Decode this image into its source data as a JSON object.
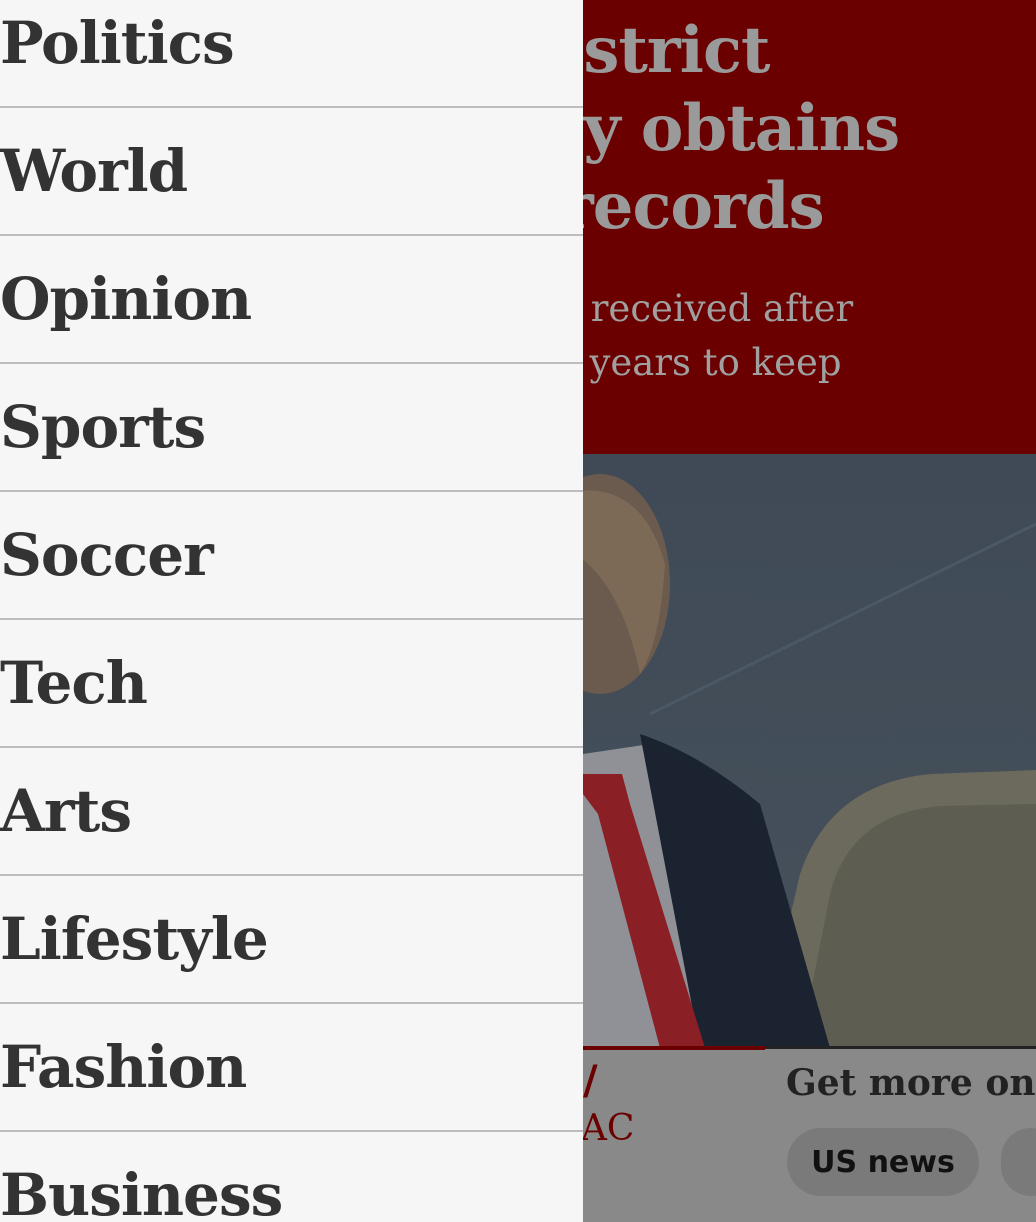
{
  "article": {
    "headline_lines": [
      "istrict",
      "ly obtains",
      "records"
    ],
    "standfirst_lines": [
      "s received after",
      "r years to keep"
    ],
    "kicker_slash": "/",
    "kicker_text": "PAC",
    "more_heading": "Get more on t",
    "chips": [
      "US news",
      ""
    ]
  },
  "nav": {
    "items": [
      {
        "label": "Politics"
      },
      {
        "label": "World"
      },
      {
        "label": "Opinion"
      },
      {
        "label": "Sports"
      },
      {
        "label": "Soccer"
      },
      {
        "label": "Tech"
      },
      {
        "label": "Arts"
      },
      {
        "label": "Lifestyle"
      },
      {
        "label": "Fashion"
      },
      {
        "label": "Business"
      }
    ]
  },
  "colors": {
    "brand_red": "#6a0000",
    "drawer_bg": "#f6f6f6",
    "nav_text": "#333333",
    "divider": "#bdbdbd"
  }
}
